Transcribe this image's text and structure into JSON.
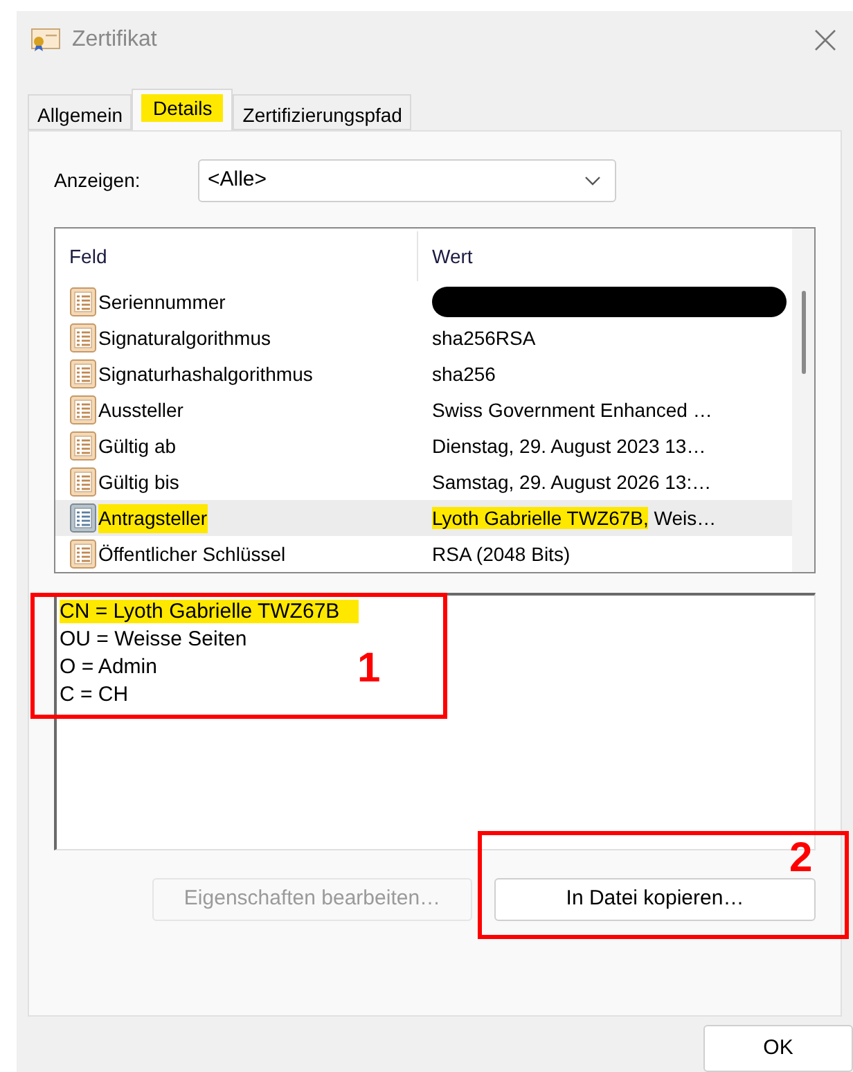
{
  "window": {
    "title": "Zertifikat"
  },
  "tabs": [
    {
      "label": "Allgemein",
      "selected": false,
      "highlighted": false
    },
    {
      "label": "Details",
      "selected": true,
      "highlighted": true
    },
    {
      "label": "Zertifizierungspfad",
      "selected": false,
      "highlighted": false
    }
  ],
  "show": {
    "label": "Anzeigen:",
    "value": "<Alle>"
  },
  "fields_table": {
    "columns": [
      "Feld",
      "Wert"
    ],
    "rows": [
      {
        "field": "Seriennummer",
        "field_highlighted": false,
        "redacted": true,
        "selected": false
      },
      {
        "field": "Signaturalgorithmus",
        "field_highlighted": false,
        "redacted": false,
        "selected": false,
        "value": [
          {
            "text": "sha256RSA",
            "highlighted": false
          }
        ]
      },
      {
        "field": "Signaturhashalgorithmus",
        "field_highlighted": false,
        "redacted": false,
        "selected": false,
        "value": [
          {
            "text": "sha256",
            "highlighted": false
          }
        ]
      },
      {
        "field": "Aussteller",
        "field_highlighted": false,
        "redacted": false,
        "selected": false,
        "value": [
          {
            "text": "Swiss Government Enhanced …",
            "highlighted": false
          }
        ]
      },
      {
        "field": "Gültig ab",
        "field_highlighted": false,
        "redacted": false,
        "selected": false,
        "value": [
          {
            "text": "Dienstag, 29. August 2023 13…",
            "highlighted": false
          }
        ]
      },
      {
        "field": "Gültig bis",
        "field_highlighted": false,
        "redacted": false,
        "selected": false,
        "value": [
          {
            "text": "Samstag, 29. August 2026 13:…",
            "highlighted": false
          }
        ]
      },
      {
        "field": "Antragsteller",
        "field_highlighted": true,
        "redacted": false,
        "selected": true,
        "value": [
          {
            "text": "Lyoth Gabrielle TWZ67B,",
            "highlighted": true
          },
          {
            "text": " Weis…",
            "highlighted": false
          }
        ]
      },
      {
        "field": "Öffentlicher Schlüssel",
        "field_highlighted": false,
        "redacted": false,
        "selected": false,
        "value": [
          {
            "text": "RSA (2048 Bits)",
            "highlighted": false
          }
        ]
      }
    ]
  },
  "detail_lines": [
    {
      "text": "CN = Lyoth Gabrielle TWZ67B",
      "highlighted": true
    },
    {
      "text": "OU = Weisse Seiten",
      "highlighted": false
    },
    {
      "text": "O = Admin",
      "highlighted": false
    },
    {
      "text": "C = CH",
      "highlighted": false
    }
  ],
  "buttons": [
    {
      "label": "Eigenschaften bearbeiten…",
      "disabled": true
    },
    {
      "label": "In Datei kopieren…",
      "disabled": false
    }
  ],
  "ok_button": {
    "label": "OK"
  },
  "annotations": [
    {
      "label": "1"
    },
    {
      "label": "2"
    }
  ]
}
